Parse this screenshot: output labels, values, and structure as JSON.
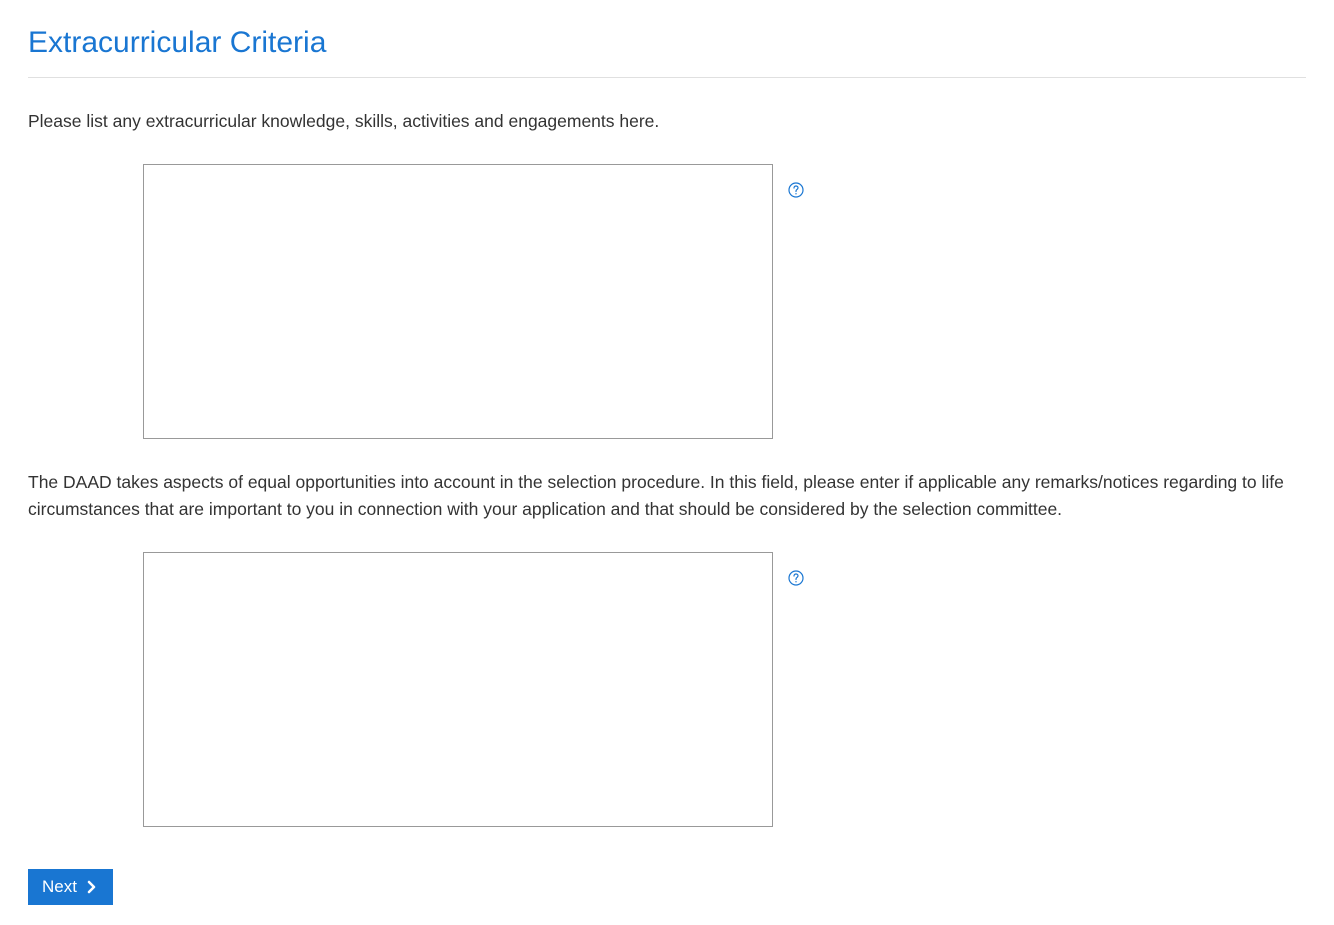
{
  "heading": "Extracurricular Criteria",
  "fields": {
    "extracurricular": {
      "label": "Please list any extracurricular knowledge, skills, activities and engagements here.",
      "value": ""
    },
    "equal_opportunities": {
      "label": "The DAAD takes aspects of equal opportunities into account in the selection procedure. In this field, please enter if applicable any remarks/notices regarding to life circumstances that are important to you in connection with your application and that should be considered by the selection committee.",
      "value": ""
    }
  },
  "buttons": {
    "next_label": "Next"
  }
}
